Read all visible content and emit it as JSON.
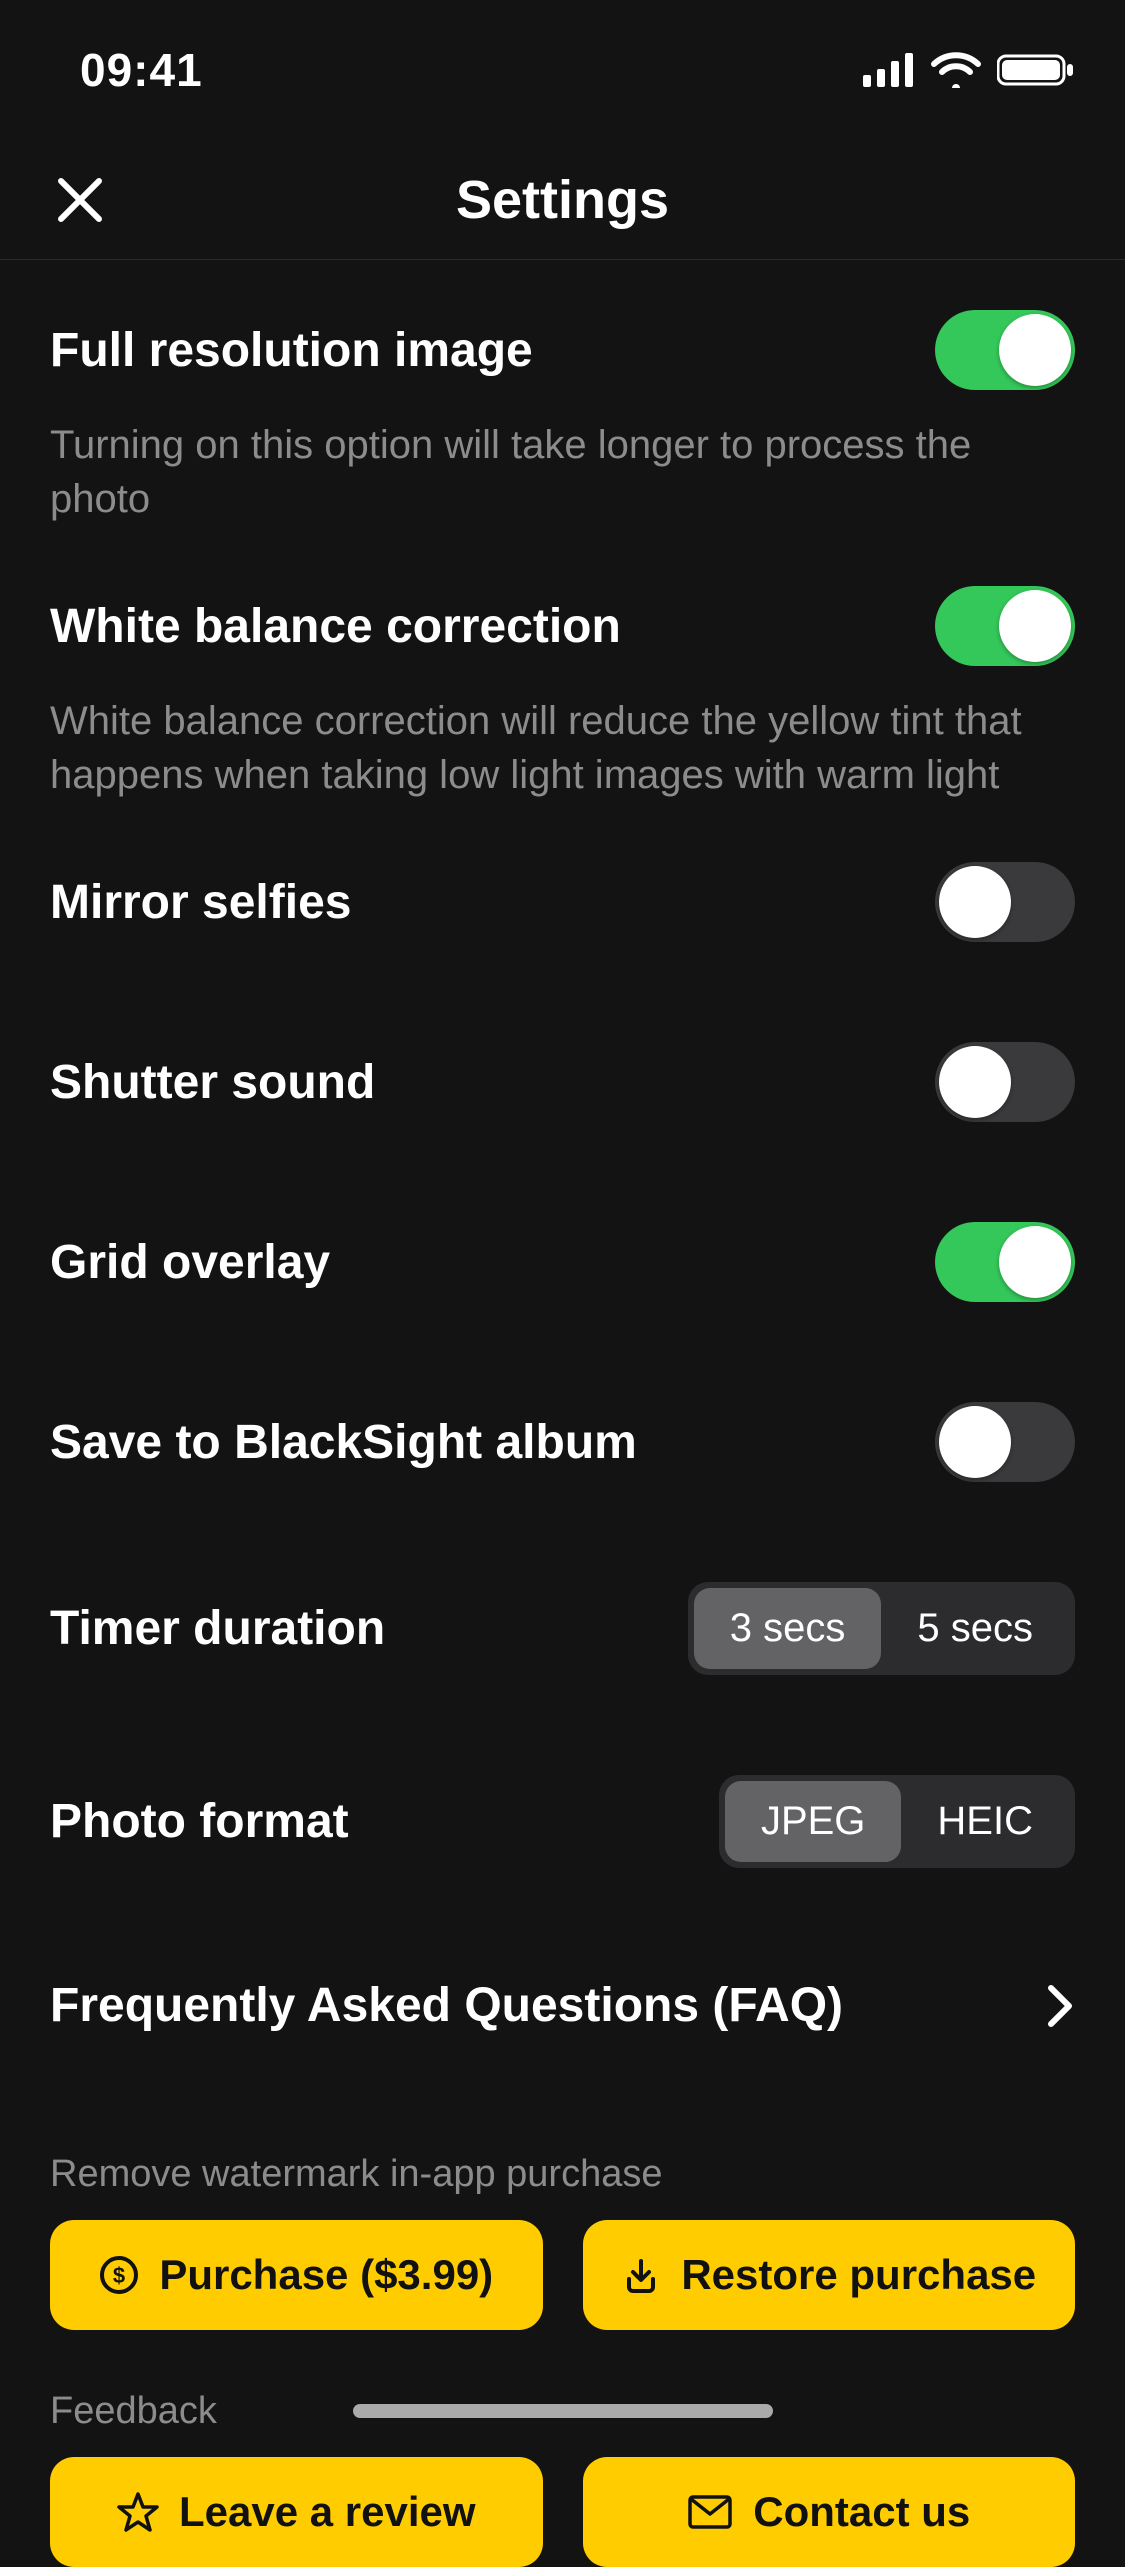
{
  "status": {
    "time": "09:41"
  },
  "header": {
    "title": "Settings"
  },
  "settings": {
    "full_res": {
      "title": "Full resolution image",
      "desc": "Turning on this option will take longer to process the photo",
      "on": true
    },
    "white_balance": {
      "title": "White balance correction",
      "desc": "White balance correction will reduce the yellow tint that happens when taking low light images with warm light",
      "on": true
    },
    "mirror_selfies": {
      "title": "Mirror selfies",
      "on": false
    },
    "shutter_sound": {
      "title": "Shutter sound",
      "on": false
    },
    "grid_overlay": {
      "title": "Grid overlay",
      "on": true
    },
    "save_album": {
      "title": "Save to BlackSight album",
      "on": false
    },
    "timer": {
      "title": "Timer duration",
      "options": [
        "3 secs",
        "5 secs"
      ],
      "selected": "3 secs"
    },
    "photo_format": {
      "title": "Photo format",
      "options": [
        "JPEG",
        "HEIC"
      ],
      "selected": "JPEG"
    },
    "faq": {
      "title": "Frequently Asked Questions (FAQ)"
    }
  },
  "purchase": {
    "section_label": "Remove watermark in-app purchase",
    "buy_label": "Purchase ($3.99)",
    "restore_label": "Restore purchase"
  },
  "feedback": {
    "section_label": "Feedback",
    "review_label": "Leave a review",
    "contact_label": "Contact us"
  },
  "colors": {
    "accent": "#ffcc00",
    "toggle_on": "#34c759"
  }
}
